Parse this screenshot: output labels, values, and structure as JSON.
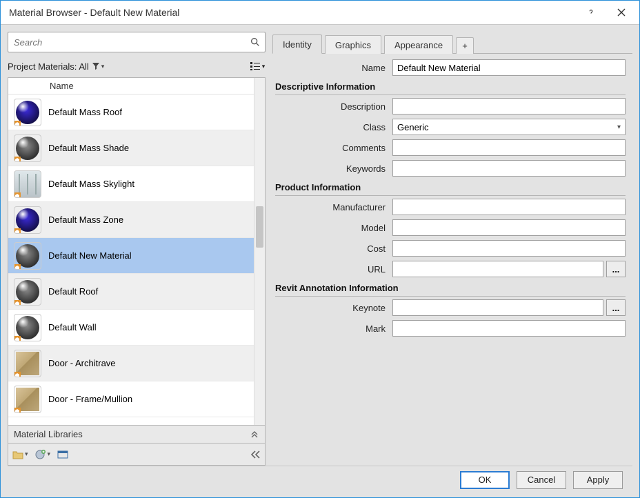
{
  "window": {
    "title": "Material Browser - Default New Material"
  },
  "search": {
    "placeholder": "Search"
  },
  "project_header": {
    "label": "Project Materials: All"
  },
  "list_column": "Name",
  "materials": [
    {
      "name": "Default Mass Roof",
      "thumb": "sphere",
      "color": "#3b2bd9",
      "alt": false
    },
    {
      "name": "Default Mass Shade",
      "thumb": "sphere",
      "color": "#8a8a8a",
      "alt": true
    },
    {
      "name": "Default Mass Skylight",
      "thumb": "glass",
      "color": "#c0cdd3",
      "alt": false
    },
    {
      "name": "Default Mass Zone",
      "thumb": "sphere",
      "color": "#3b2bd9",
      "alt": true
    },
    {
      "name": "Default New Material",
      "thumb": "sphere",
      "color": "#8a8a8a",
      "alt": false,
      "selected": true
    },
    {
      "name": "Default Roof",
      "thumb": "sphere",
      "color": "#8a8a8a",
      "alt": true
    },
    {
      "name": "Default Wall",
      "thumb": "sphere",
      "color": "#8a8a8a",
      "alt": false
    },
    {
      "name": "Door - Architrave",
      "thumb": "box",
      "color": "#c7a97a",
      "alt": true
    },
    {
      "name": "Door - Frame/Mullion",
      "thumb": "box",
      "color": "#c7a97a",
      "alt": false
    }
  ],
  "libraries_label": "Material Libraries",
  "tabs": {
    "identity": "Identity",
    "graphics": "Graphics",
    "appearance": "Appearance",
    "add": "+"
  },
  "name_field": {
    "label": "Name",
    "value": "Default New Material"
  },
  "sections": {
    "descriptive": "Descriptive Information",
    "product": "Product Information",
    "annotation": "Revit Annotation Information"
  },
  "fields": {
    "description": "Description",
    "class_label": "Class",
    "class_value": "Generic",
    "comments": "Comments",
    "keywords": "Keywords",
    "manufacturer": "Manufacturer",
    "model": "Model",
    "cost": "Cost",
    "url": "URL",
    "keynote": "Keynote",
    "mark": "Mark"
  },
  "browse_btn": "...",
  "footer": {
    "ok": "OK",
    "cancel": "Cancel",
    "apply": "Apply"
  }
}
